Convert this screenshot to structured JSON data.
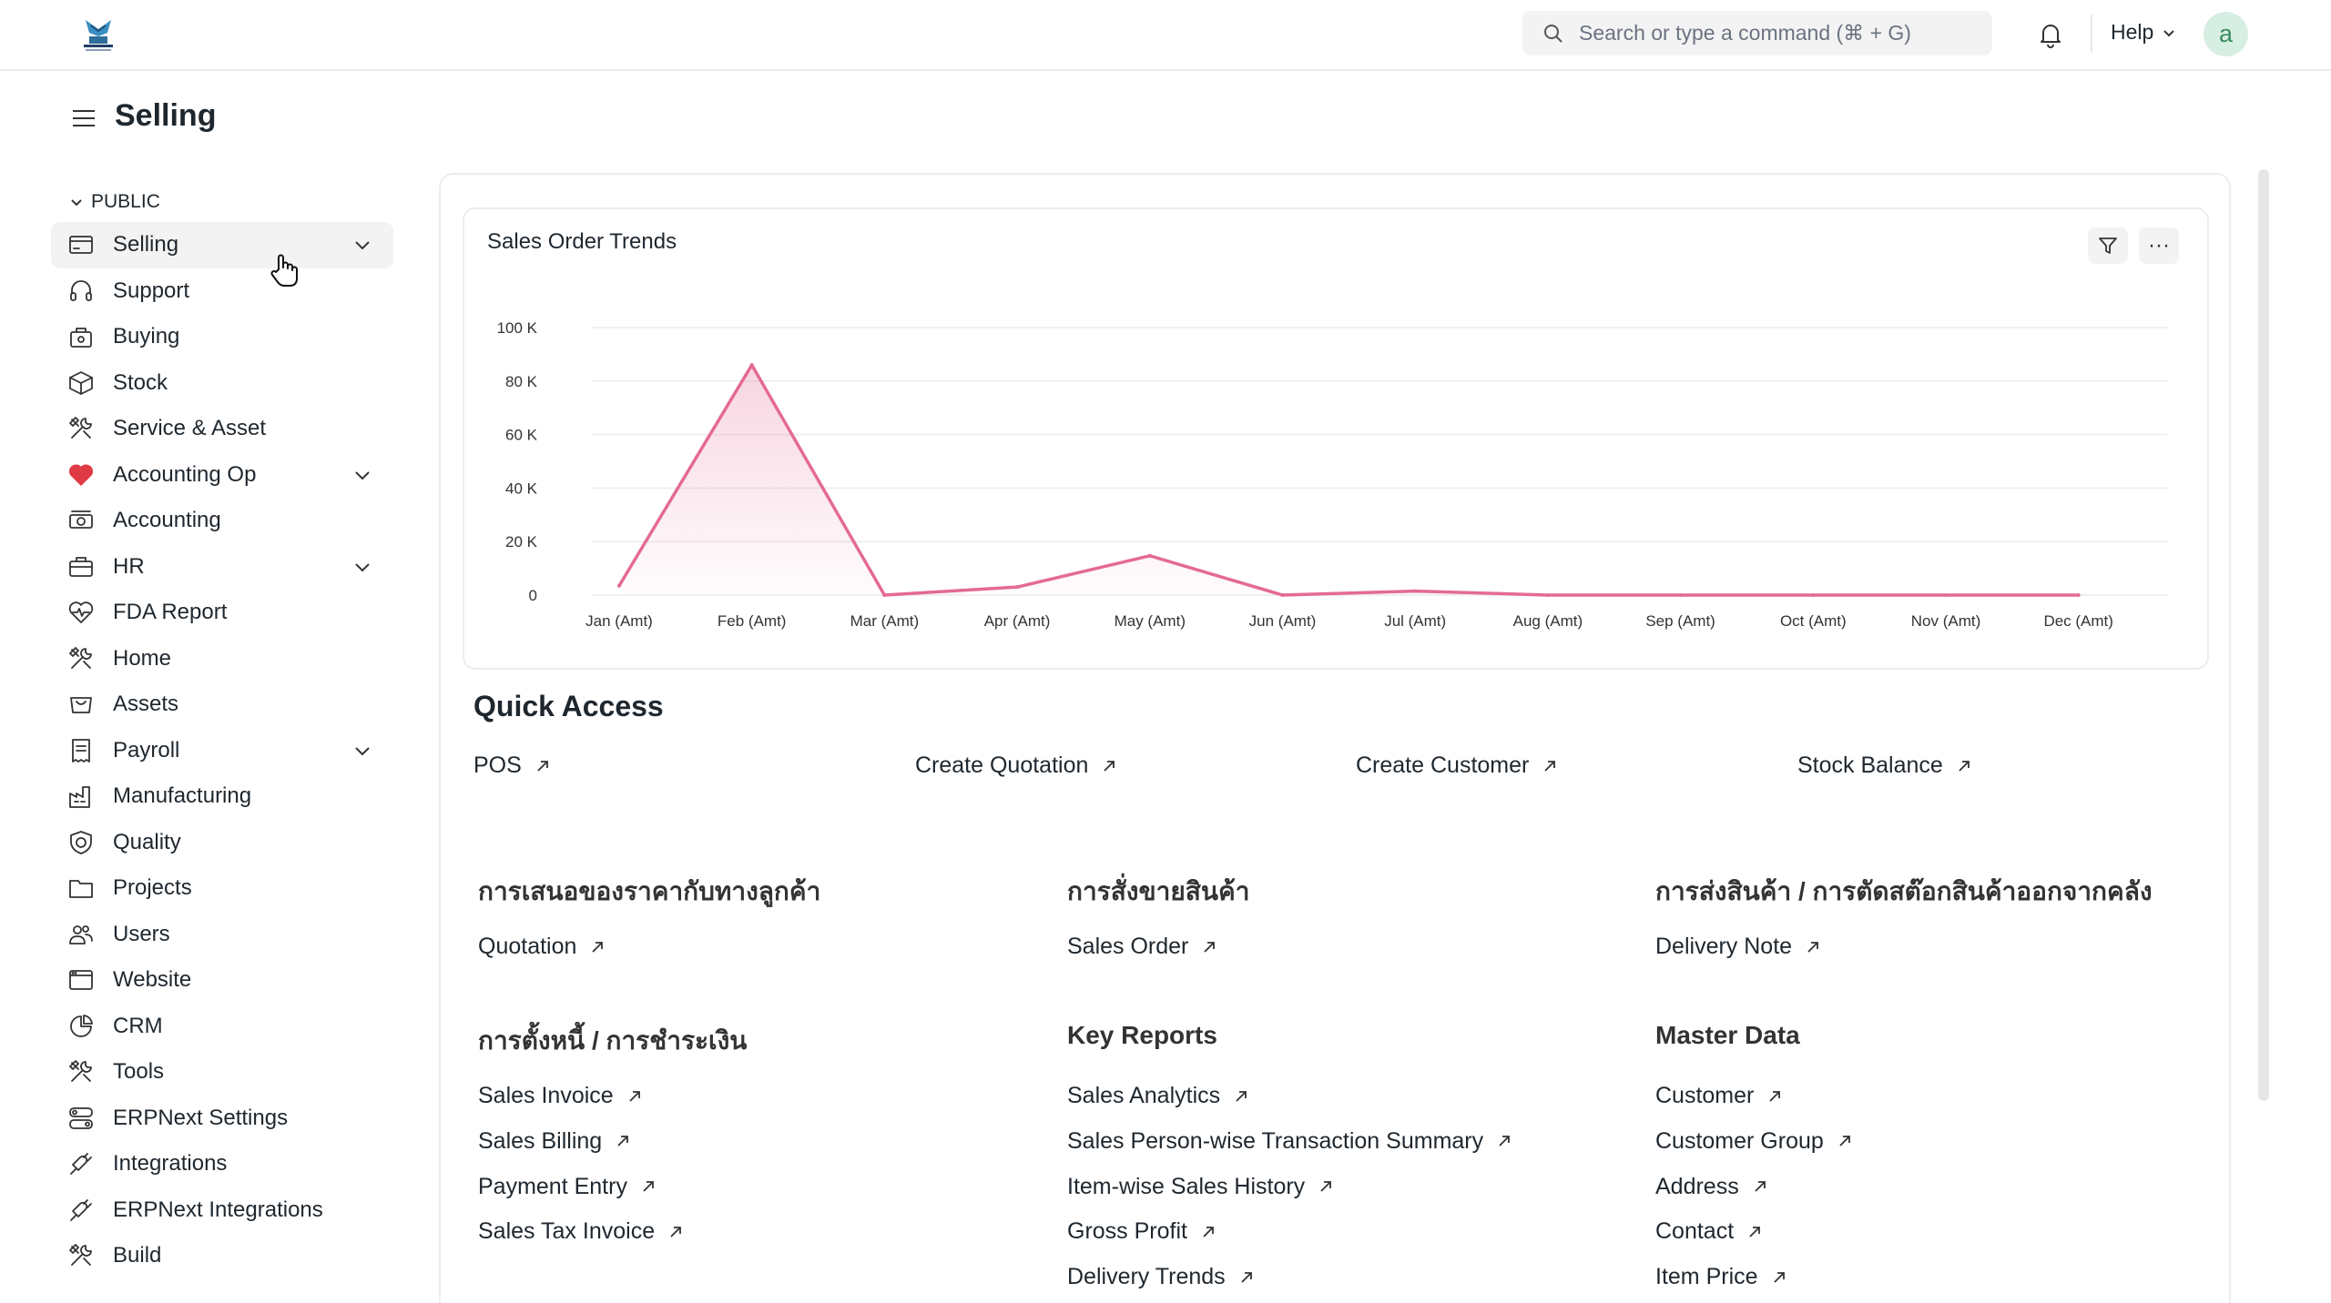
{
  "navbar": {
    "search_placeholder": "Search or type a command (⌘ + G)",
    "help_label": "Help",
    "avatar_initial": "a"
  },
  "page": {
    "title": "Selling"
  },
  "sidebar": {
    "section_label": "PUBLIC",
    "items": [
      {
        "label": "Selling",
        "icon": "card-icon",
        "expandable": true,
        "active": true
      },
      {
        "label": "Support",
        "icon": "headset-icon",
        "expandable": false
      },
      {
        "label": "Buying",
        "icon": "bag-icon",
        "expandable": false
      },
      {
        "label": "Stock",
        "icon": "box-icon",
        "expandable": false
      },
      {
        "label": "Service & Asset",
        "icon": "tools-icon",
        "expandable": false
      },
      {
        "label": "Accounting Op",
        "icon": "heart-icon",
        "expandable": true
      },
      {
        "label": "Accounting",
        "icon": "money-icon",
        "expandable": false
      },
      {
        "label": "HR",
        "icon": "briefcase-icon",
        "expandable": true
      },
      {
        "label": "FDA Report",
        "icon": "pulse-icon",
        "expandable": false
      },
      {
        "label": "Home",
        "icon": "tools-icon",
        "expandable": false
      },
      {
        "label": "Assets",
        "icon": "cart-icon",
        "expandable": false
      },
      {
        "label": "Payroll",
        "icon": "receipt-icon",
        "expandable": true
      },
      {
        "label": "Manufacturing",
        "icon": "factory-icon",
        "expandable": false
      },
      {
        "label": "Quality",
        "icon": "shield-icon",
        "expandable": false
      },
      {
        "label": "Projects",
        "icon": "folder-icon",
        "expandable": false
      },
      {
        "label": "Users",
        "icon": "users-icon",
        "expandable": false
      },
      {
        "label": "Website",
        "icon": "browser-icon",
        "expandable": false
      },
      {
        "label": "CRM",
        "icon": "pie-icon",
        "expandable": false
      },
      {
        "label": "Tools",
        "icon": "tools-icon",
        "expandable": false
      },
      {
        "label": "ERPNext Settings",
        "icon": "settings-icon",
        "expandable": false
      },
      {
        "label": "Integrations",
        "icon": "plug-icon",
        "expandable": false
      },
      {
        "label": "ERPNext Integrations",
        "icon": "plug-icon",
        "expandable": false
      },
      {
        "label": "Build",
        "icon": "tools-icon",
        "expandable": false
      }
    ]
  },
  "chart": {
    "title": "Sales Order Trends",
    "filter_icon": "filter-icon",
    "more_label": "···"
  },
  "chart_data": {
    "type": "area",
    "title": "Sales Order Trends",
    "categories": [
      "Jan (Amt)",
      "Feb (Amt)",
      "Mar (Amt)",
      "Apr (Amt)",
      "May (Amt)",
      "Jun (Amt)",
      "Jul (Amt)",
      "Aug (Amt)",
      "Sep (Amt)",
      "Oct (Amt)",
      "Nov (Amt)",
      "Dec (Amt)"
    ],
    "values": [
      3500,
      86000,
      0,
      3000,
      14700,
      0,
      1500,
      0,
      0,
      0,
      0,
      0
    ],
    "yticks": [
      "0",
      "20 K",
      "40 K",
      "60 K",
      "80 K",
      "100 K"
    ],
    "ylim": [
      0,
      100000
    ],
    "grid": true,
    "color": "#e46a95"
  },
  "quick_access": {
    "title": "Quick Access",
    "links": [
      "POS",
      "Create Quotation",
      "Create Customer",
      "Stock Balance"
    ]
  },
  "cards": [
    {
      "title": "การเสนอของราคากับทางลูกค้า",
      "links": [
        "Quotation"
      ]
    },
    {
      "title": "การสั่งขายสินค้า",
      "links": [
        "Sales Order"
      ]
    },
    {
      "title": "การส่งสินค้า / การตัดสต๊อกสินค้าออกจากคลัง",
      "links": [
        "Delivery Note"
      ]
    },
    {
      "title": "การตั้งหนี้ / การชำระเงิน",
      "links": [
        "Sales Invoice",
        "Sales Billing",
        "Payment Entry",
        "Sales Tax Invoice"
      ]
    },
    {
      "title": "Key Reports",
      "links": [
        "Sales Analytics",
        "Sales Person-wise Transaction Summary",
        "Item-wise Sales History",
        "Gross Profit",
        "Delivery Trends"
      ]
    },
    {
      "title": "Master Data",
      "links": [
        "Customer",
        "Customer Group",
        "Address",
        "Contact",
        "Item Price"
      ]
    }
  ]
}
